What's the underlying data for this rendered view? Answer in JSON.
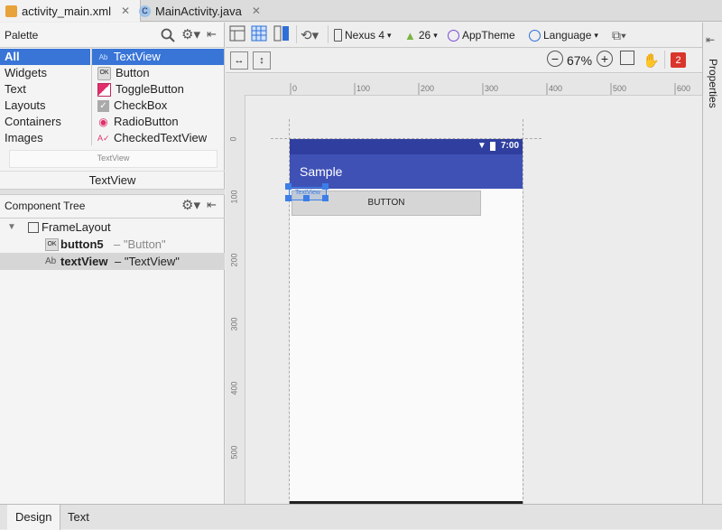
{
  "tabs": [
    {
      "label": "activity_main.xml",
      "close": "✕"
    },
    {
      "label": "MainActivity.java",
      "close": "✕"
    }
  ],
  "palette": {
    "title": "Palette",
    "categories": [
      "All",
      "Widgets",
      "Text",
      "Layouts",
      "Containers",
      "Images"
    ],
    "items": [
      {
        "label": "TextView",
        "icon": "Ab"
      },
      {
        "label": "Button",
        "icon": "OK"
      },
      {
        "label": "ToggleButton",
        "icon": ""
      },
      {
        "label": "CheckBox",
        "icon": "✓"
      },
      {
        "label": "RadioButton",
        "icon": "◉"
      },
      {
        "label": "CheckedTextView",
        "icon": "A✓"
      }
    ],
    "preview_caption": "TextView",
    "selected_name": "TextView"
  },
  "component_tree": {
    "title": "Component Tree",
    "root": "FrameLayout",
    "rows": [
      {
        "icon": "OK",
        "id": "button5",
        "text": "– \"Button\""
      },
      {
        "icon": "Ab",
        "id": "textView",
        "text": "– \"TextView\""
      }
    ]
  },
  "toolbar": {
    "device": "Nexus 4",
    "api": "26",
    "theme": "AppTheme",
    "language": "Language",
    "zoom": "67%",
    "error_count": "2"
  },
  "ruler": {
    "h": [
      "0",
      "100",
      "200",
      "300",
      "400",
      "500",
      "600"
    ],
    "v": [
      "0",
      "100",
      "200",
      "300",
      "400",
      "500"
    ]
  },
  "device": {
    "status_time": "7:00",
    "app_title": "Sample",
    "button_label": "BUTTON",
    "textview_label": "TextView"
  },
  "right_panel": {
    "label": "Properties"
  },
  "bottom_tabs": [
    "Design",
    "Text"
  ],
  "colors": {
    "selection": "#3875d7",
    "toolbar_blue": "#3f51b5",
    "status_dark": "#303f9f",
    "error": "#d9352c"
  }
}
